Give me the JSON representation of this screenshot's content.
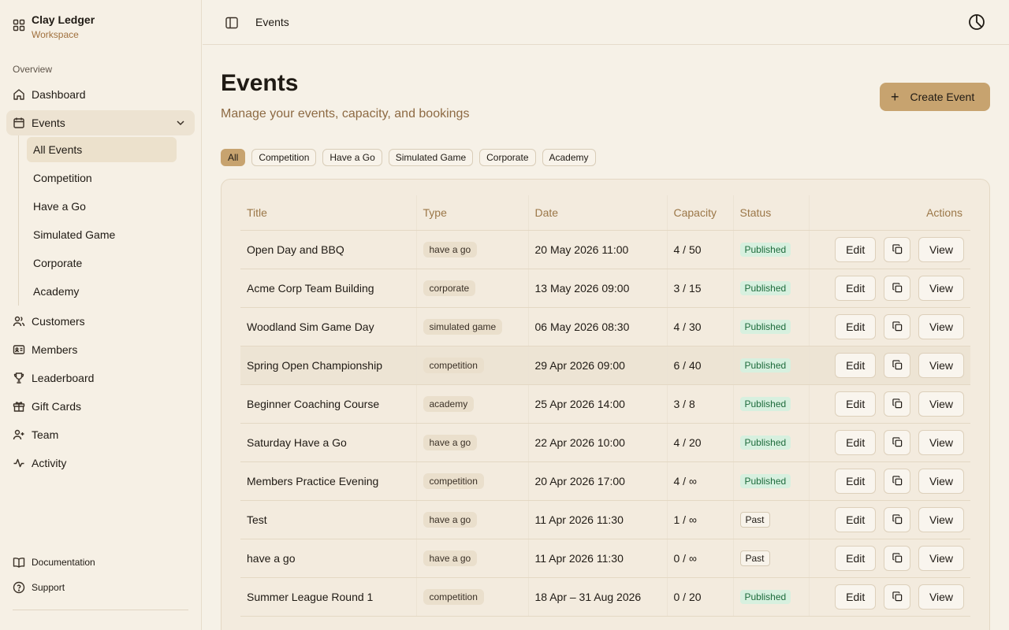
{
  "brand": {
    "name": "Clay Ledger",
    "sub": "Workspace"
  },
  "sidebar": {
    "section": "Overview",
    "dashboard": "Dashboard",
    "events": "Events",
    "sub": [
      "All Events",
      "Competition",
      "Have a Go",
      "Simulated Game",
      "Corporate",
      "Academy"
    ],
    "customers": "Customers",
    "members": "Members",
    "leaderboard": "Leaderboard",
    "gift_cards": "Gift Cards",
    "team": "Team",
    "activity": "Activity",
    "documentation": "Documentation",
    "support": "Support"
  },
  "topbar": {
    "crumb": "Events"
  },
  "page": {
    "title": "Events",
    "description": "Manage your events, capacity, and bookings",
    "create_label": "Create Event"
  },
  "filters": [
    "All",
    "Competition",
    "Have a Go",
    "Simulated Game",
    "Corporate",
    "Academy"
  ],
  "table": {
    "headers": {
      "title": "Title",
      "type": "Type",
      "date": "Date",
      "capacity": "Capacity",
      "status": "Status",
      "actions": "Actions"
    },
    "buttons": {
      "edit": "Edit",
      "view": "View"
    },
    "rows": [
      {
        "title": "Open Day and BBQ",
        "type": "have a go",
        "date": "20 May 2026 11:00",
        "capacity": "4 / 50",
        "status": "Published"
      },
      {
        "title": "Acme Corp Team Building",
        "type": "corporate",
        "date": "13 May 2026 09:00",
        "capacity": "3 / 15",
        "status": "Published"
      },
      {
        "title": "Woodland Sim Game Day",
        "type": "simulated game",
        "date": "06 May 2026 08:30",
        "capacity": "4 / 30",
        "status": "Published"
      },
      {
        "title": "Spring Open Championship",
        "type": "competition",
        "date": "29 Apr 2026 09:00",
        "capacity": "6 / 40",
        "status": "Published"
      },
      {
        "title": "Beginner Coaching Course",
        "type": "academy",
        "date": "25 Apr 2026 14:00",
        "capacity": "3 / 8",
        "status": "Published"
      },
      {
        "title": "Saturday Have a Go",
        "type": "have a go",
        "date": "22 Apr 2026 10:00",
        "capacity": "4 / 20",
        "status": "Published"
      },
      {
        "title": "Members Practice Evening",
        "type": "competition",
        "date": "20 Apr 2026 17:00",
        "capacity": "4 / ∞",
        "status": "Published"
      },
      {
        "title": "Test",
        "type": "have a go",
        "date": "11 Apr 2026 11:30",
        "capacity": "1 / ∞",
        "status": "Past"
      },
      {
        "title": "have a go",
        "type": "have a go",
        "date": "11 Apr 2026 11:30",
        "capacity": "0 / ∞",
        "status": "Past"
      },
      {
        "title": "Summer League Round 1",
        "type": "competition",
        "date": "18 Apr – 31 Aug 2026",
        "capacity": "0 / 20",
        "status": "Published"
      }
    ]
  },
  "colors": {
    "accent": "#c7a36f",
    "published_bg": "#d7f0df",
    "published_fg": "#1e6b3c"
  }
}
